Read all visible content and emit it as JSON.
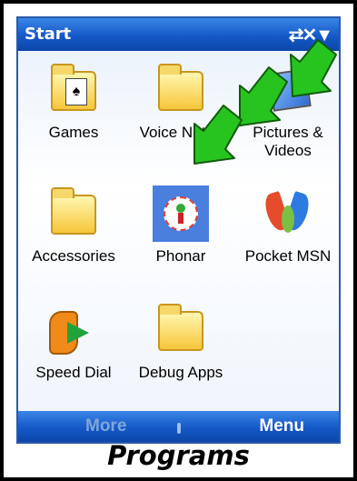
{
  "window": {
    "title": "Start"
  },
  "apps": [
    {
      "label": "Games",
      "icon": "games-folder-icon"
    },
    {
      "label": "Voice Notes",
      "icon": "voice-notes-folder-icon"
    },
    {
      "label": "Pictures & Videos",
      "icon": "pictures-videos-icon"
    },
    {
      "label": "Accessories",
      "icon": "accessories-folder-icon"
    },
    {
      "label": "Phonar",
      "icon": "phonar-icon",
      "selected": true
    },
    {
      "label": "Pocket MSN",
      "icon": "msn-butterfly-icon"
    },
    {
      "label": "Speed Dial",
      "icon": "speed-dial-icon"
    },
    {
      "label": "Debug Apps",
      "icon": "debug-apps-folder-icon"
    }
  ],
  "softkeys": {
    "left": "More",
    "right": "Menu"
  },
  "caption": "Programs",
  "colors": {
    "titlebar": "#1558c8",
    "selection": "#4a7fde",
    "arrow": "#22c21b"
  }
}
